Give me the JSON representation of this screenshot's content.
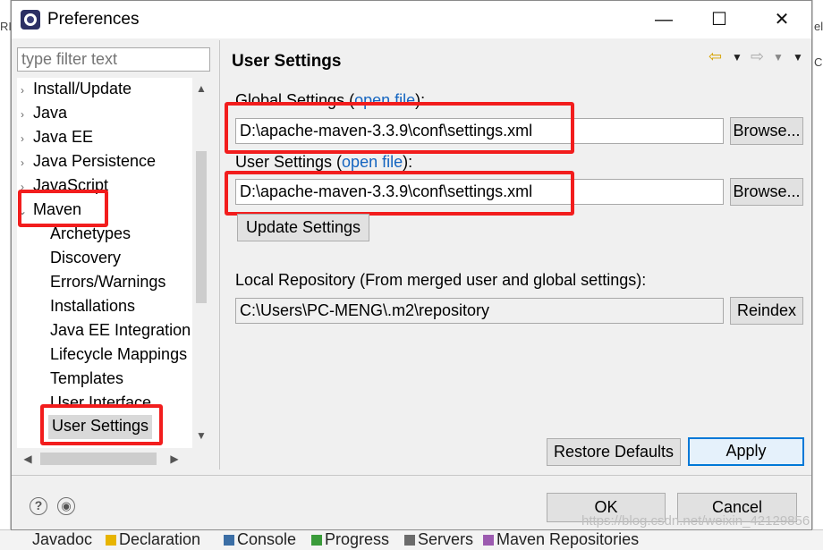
{
  "dialog": {
    "title": "Preferences",
    "window_controls": {
      "minimize": "—",
      "maximize": "☐",
      "close": "✕"
    }
  },
  "background": {
    "left_fragment": "RI",
    "right_fragments": [
      "el",
      "C"
    ],
    "bottom_tabs": [
      "Javadoc",
      "Declaration",
      "Console",
      "Progress",
      "Servers",
      "Maven Repositories"
    ]
  },
  "sidebar": {
    "filter_placeholder": "type filter text",
    "items": [
      {
        "label": "Install/Update",
        "expander": "›"
      },
      {
        "label": "Java",
        "expander": "›"
      },
      {
        "label": "Java EE",
        "expander": "›"
      },
      {
        "label": "Java Persistence",
        "expander": "›"
      },
      {
        "label": "JavaScript",
        "expander": "›"
      },
      {
        "label": "Maven",
        "expander": "⌄"
      },
      {
        "label": "Archetypes"
      },
      {
        "label": "Discovery"
      },
      {
        "label": "Errors/Warnings"
      },
      {
        "label": "Installations"
      },
      {
        "label": "Java EE Integration"
      },
      {
        "label": "Lifecycle Mappings"
      },
      {
        "label": "Templates"
      },
      {
        "label": "User Interface"
      },
      {
        "label": "User Settings"
      }
    ],
    "scroll": {
      "up": "▲",
      "down": "▼",
      "left": "◀",
      "right": "▶"
    }
  },
  "page": {
    "title": "User Settings",
    "nav": {
      "back": "⇦",
      "menu": "▼",
      "forward": "⇨",
      "forward_menu": "▼",
      "view_menu": "▼"
    },
    "global_settings": {
      "label": "Global Settings (",
      "link": "open file",
      "label_end": "):",
      "value": "D:\\apache-maven-3.3.9\\conf\\settings.xml",
      "browse": "Browse..."
    },
    "user_settings": {
      "label": "User Settings (",
      "link": "open file",
      "label_end": "):",
      "value": "D:\\apache-maven-3.3.9\\conf\\settings.xml",
      "browse": "Browse..."
    },
    "update_button": "Update Settings",
    "local_repo": {
      "label": "Local Repository (From merged user and global settings):",
      "value": "C:\\Users\\PC-MENG\\.m2\\repository",
      "reindex": "Reindex"
    },
    "restore_defaults": "Restore Defaults",
    "apply": "Apply"
  },
  "footer": {
    "help_icon": "?",
    "import_icon": "◉",
    "ok": "OK",
    "cancel": "Cancel",
    "watermark": "https://blog.csdn.net/weixin_42129856"
  },
  "colors": {
    "highlight": "#f21d1d",
    "link": "#1565c0",
    "selection": "#d9d9d9",
    "default_button_border": "#0078d7"
  }
}
